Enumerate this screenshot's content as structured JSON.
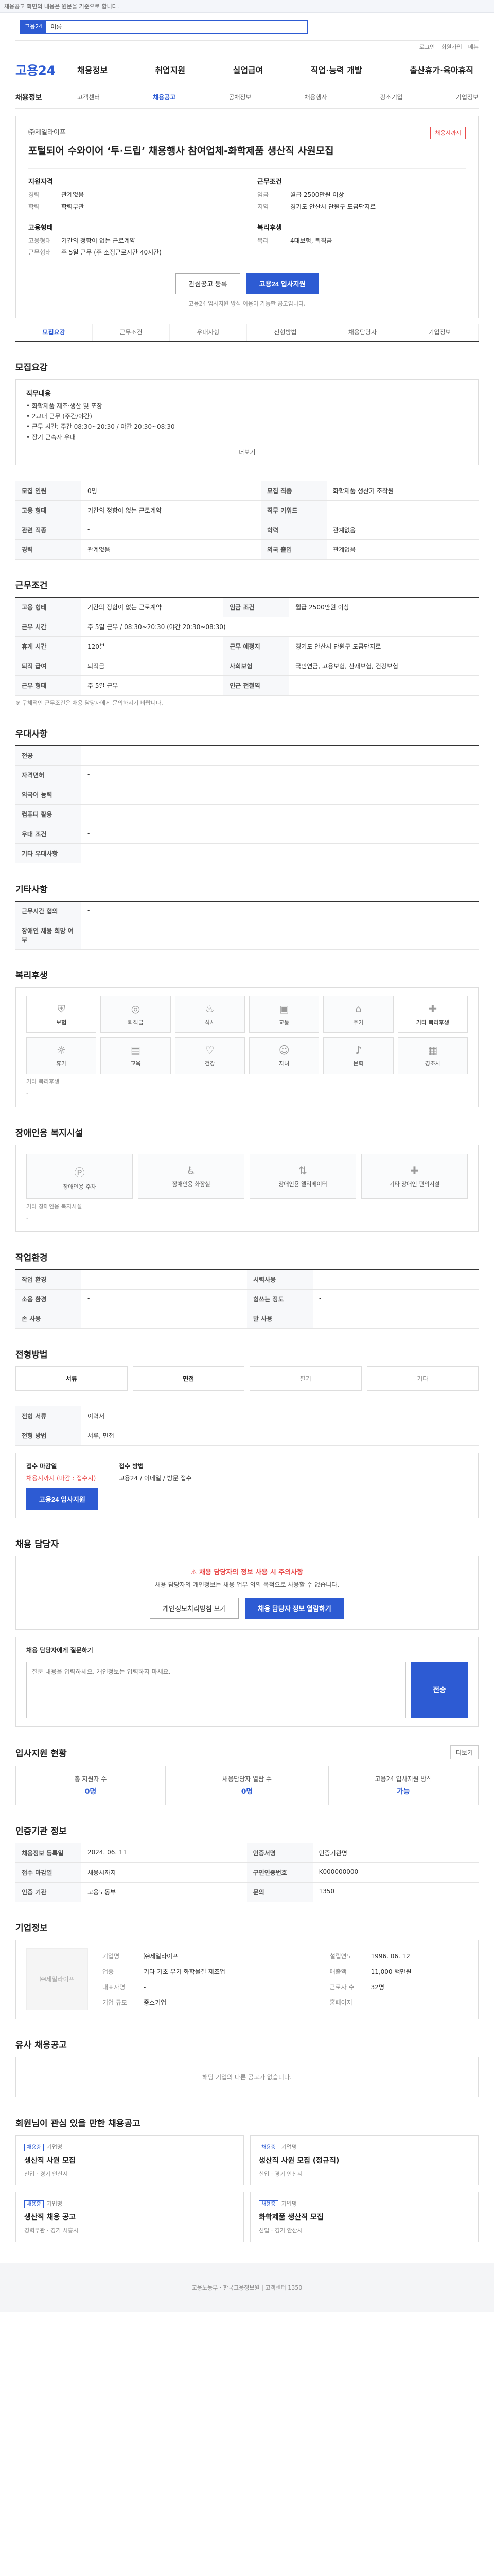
{
  "topnotice": "채용공고 화면의 내용은 원문을 기준으로 합니다.",
  "search": {
    "tag": "고용24",
    "query": "이름"
  },
  "utility": [
    "로그인",
    "회원가입",
    "메뉴"
  ],
  "gnb": {
    "logo": "고용24",
    "menu": [
      "채용정보",
      "취업지원",
      "실업급여",
      "직업·능력 개발",
      "출산휴가·육아휴직"
    ]
  },
  "subnav": {
    "title": "채용정보",
    "items": [
      "고객센터",
      "채용공고",
      "공채정보",
      "채용행사",
      "강소기업",
      "기업정보"
    ],
    "active": 1
  },
  "tabs": [
    "모집요강",
    "근무조건",
    "우대사항",
    "전형방법",
    "채용담당자",
    "기업정보"
  ],
  "job": {
    "company": "㈜제일라이프",
    "badge": "채용시까지",
    "title": "포털되어 수와이어 ‘투·드립’ 채용행사 참여업체-화학제품 생산직 사원모집",
    "groups": [
      {
        "title": "지원자격",
        "rows": [
          {
            "k": "경력",
            "v": "관계없음"
          },
          {
            "k": "학력",
            "v": "학력무관"
          }
        ]
      },
      {
        "title": "근무조건",
        "rows": [
          {
            "k": "임금",
            "v": "월급 2500만원 이상"
          },
          {
            "k": "지역",
            "v": "경기도 안산시 단원구 도금단지로"
          }
        ]
      },
      {
        "title": "고용형태",
        "rows": [
          {
            "k": "고용형태",
            "v": "기간의 정함이 없는 근로계약"
          },
          {
            "k": "근무형태",
            "v": "주 5일 근무 (주 소정근로시간 40시간)"
          }
        ]
      },
      {
        "title": "복리후생",
        "rows": [
          {
            "k": "복리",
            "v": "4대보험, 퇴직금"
          }
        ]
      }
    ],
    "btn_scrap": "관심공고 등록",
    "btn_apply": "고용24 입사지원",
    "note": "고용24 입사지원 방식 이용이 가능한 공고입니다."
  },
  "duty": {
    "section": "모집요강",
    "head": "직무내용",
    "lines": [
      "• 화학제품 제조·생산 및 포장",
      "• 2교대 근무 (주간/야간)",
      "• 근무 시간: 주간 08:30~20:30 / 야간 20:30~08:30",
      "• 장기 근속자 우대"
    ],
    "more": "더보기"
  },
  "recruit_rows": [
    {
      "k": "모집 인원",
      "v": "0명"
    },
    {
      "k": "모집 직종",
      "v": "화학제품 생산기 조작원"
    },
    {
      "k": "고용 형태",
      "v": "기간의 정함이 없는 근로계약"
    },
    {
      "k": "직무 키워드",
      "v": "-"
    },
    {
      "k": "관련 직종",
      "v": "-"
    },
    {
      "k": "학력",
      "v": "관계없음"
    },
    {
      "k": "경력",
      "v": "관계없음"
    },
    {
      "k": "외국 출입",
      "v": "관계없음"
    }
  ],
  "work": {
    "section": "근무조건",
    "rows": [
      {
        "k": "고용 형태",
        "v": "기간의 정함이 없는 근로계약"
      },
      {
        "k": "임금 조건",
        "v": "월급 2500만원 이상"
      },
      {
        "k": "근무 시간",
        "v": "주 5일 근무 / 08:30~20:30 (야간 20:30~08:30)"
      },
      {
        "k": "휴게 시간",
        "v": "120분"
      },
      {
        "k": "근무 예정지",
        "v": "경기도 안산시 단원구 도금단지로"
      },
      {
        "k": "퇴직 급여",
        "v": "퇴직금"
      },
      {
        "k": "사회보험",
        "v": "국민연금, 고용보험, 산재보험, 건강보험"
      },
      {
        "k": "근무 형태",
        "v": "주 5일 근무"
      },
      {
        "k": "인근 전철역",
        "v": "-"
      }
    ],
    "mini": "※ 구체적인 근무조건은 채용 담당자에게 문의하시기 바랍니다."
  },
  "prefer": {
    "section": "우대사항",
    "rows": [
      {
        "k": "전공",
        "v": "-"
      },
      {
        "k": "자격면허",
        "v": "-"
      },
      {
        "k": "외국어 능력",
        "v": "-"
      },
      {
        "k": "컴퓨터 활용",
        "v": "-"
      },
      {
        "k": "우대 조건",
        "v": "-"
      },
      {
        "k": "기타 우대사항",
        "v": "-"
      }
    ]
  },
  "etc": {
    "section": "기타사항",
    "rows": [
      {
        "k": "근무시간 협의",
        "v": "-"
      },
      {
        "k": "장애인 채용 희망 여부",
        "v": "-"
      }
    ]
  },
  "benefit": {
    "section": "복리후생",
    "icons": [
      {
        "name": "보험",
        "on": true
      },
      {
        "name": "퇴직금",
        "on": false
      },
      {
        "name": "식사",
        "on": false
      },
      {
        "name": "교통",
        "on": false
      },
      {
        "name": "주거",
        "on": false
      },
      {
        "name": "기타 복리후생",
        "on": true
      },
      {
        "name": "휴가",
        "on": false
      },
      {
        "name": "교육",
        "on": false
      },
      {
        "name": "건강",
        "on": false
      },
      {
        "name": "자녀",
        "on": false
      },
      {
        "name": "문화",
        "on": false
      },
      {
        "name": "경조사",
        "on": false
      }
    ],
    "note": "기타 복리후생",
    "value": "-"
  },
  "disabled": {
    "section": "장애인용 복지시설",
    "items": [
      "장애인용 주차",
      "장애인용 화장실",
      "장애인용 엘리베이터",
      "기타 장애인 편의시설"
    ],
    "note": "기타 장애인용 복지시설",
    "value": "-"
  },
  "env": {
    "section": "작업환경",
    "rows": [
      {
        "k": "작업 환경",
        "v": "-",
        "k2": "시력사용",
        "v2": "-"
      },
      {
        "k": "소음 환경",
        "v": "-",
        "k2": "힘쓰는 정도",
        "v2": "-"
      },
      {
        "k": "손 사용",
        "v": "-",
        "k2": "발 사용",
        "v2": "-"
      }
    ]
  },
  "select": {
    "section": "전형방법",
    "items": [
      "서류",
      "면접",
      "필기",
      "기타"
    ],
    "active": [
      0,
      1
    ],
    "rows": [
      {
        "k": "전형 서류",
        "v": "이력서"
      },
      {
        "k": "전형 방법",
        "v": "서류, 면접"
      }
    ],
    "apply_head": "접수 마감일",
    "apply_val": "채용시까지 (마감 : 접수시)",
    "apply_method_head": "접수 방법",
    "apply_method_val": "고용24 / 이메일 / 방문 접수",
    "btn": "고용24 입사지원"
  },
  "contact": {
    "section": "채용 담당자",
    "warn": "채용 담당자의 정보 사용 시 주의사항",
    "p": "채용 담당자의 개인정보는 채용 업무 외의 목적으로 사용할 수 없습니다.",
    "btn1": "개인정보처리방침 보기",
    "btn2": "채용 담당자 정보 열람하기"
  },
  "qa": {
    "label": "채용 담당자에게 질문하기",
    "placeholder": "질문 내용을 입력하세요. 개인정보는 입력하지 마세요.",
    "send": "전송"
  },
  "status": {
    "section": "입사지원 현황",
    "more": "더보기",
    "items": [
      {
        "label": "총 지원자 수",
        "value": "0명"
      },
      {
        "label": "채용담당자 열람 수",
        "value": "0명"
      },
      {
        "label": "고용24 입사지원 방식",
        "value": "가능"
      }
    ]
  },
  "info": {
    "section": "인증기관 정보",
    "rows": [
      {
        "k": "채용정보 등록일",
        "v": "2024. 06. 11",
        "k2": "인증서명",
        "v2": "인증기관명"
      },
      {
        "k": "접수 마감일",
        "v": "채용시까지",
        "k2": "구인인증번호",
        "v2": "K000000000"
      },
      {
        "k": "인증 기관",
        "v": "고용노동부",
        "k2": "문의",
        "v2": "1350"
      }
    ]
  },
  "companyinfo": {
    "section": "기업정보",
    "logo": "㈜제일라이프",
    "rows": [
      {
        "k": "기업명",
        "v": "㈜제일라이프",
        "k2": "설립연도",
        "v2": "1996. 06. 12"
      },
      {
        "k": "업종",
        "v": "기타 기초 무기 화학물질 제조업",
        "k2": "매출액",
        "v2": "11,000 백만원"
      },
      {
        "k": "대표자명",
        "v": "-",
        "k2": "근로자 수",
        "v2": "32명"
      },
      {
        "k": "기업 규모",
        "v": "중소기업",
        "k2": "홈페이지",
        "v2": "-"
      }
    ]
  },
  "similar": {
    "section": "유사 채용공고",
    "text": "해당 기업의 다른 공고가 없습니다."
  },
  "recs": {
    "section": "회원님이 관심 있을 만한 채용공고",
    "items": [
      {
        "tag": "채용중",
        "co": "기업명",
        "title": "생산직 사원 모집",
        "meta": "신입 · 경기 안산시"
      },
      {
        "tag": "채용중",
        "co": "기업명",
        "title": "생산직 사원 모집 (정규직)",
        "meta": "신입 · 경기 안산시"
      },
      {
        "tag": "채용중",
        "co": "기업명",
        "title": "생산직 채용 공고",
        "meta": "경력무관 · 경기 시흥시"
      },
      {
        "tag": "채용중",
        "co": "기업명",
        "title": "화학제품 생산직 모집",
        "meta": "신입 · 경기 안산시"
      }
    ]
  },
  "footer": "고용노동부 · 한국고용정보원 | 고객센터 1350"
}
